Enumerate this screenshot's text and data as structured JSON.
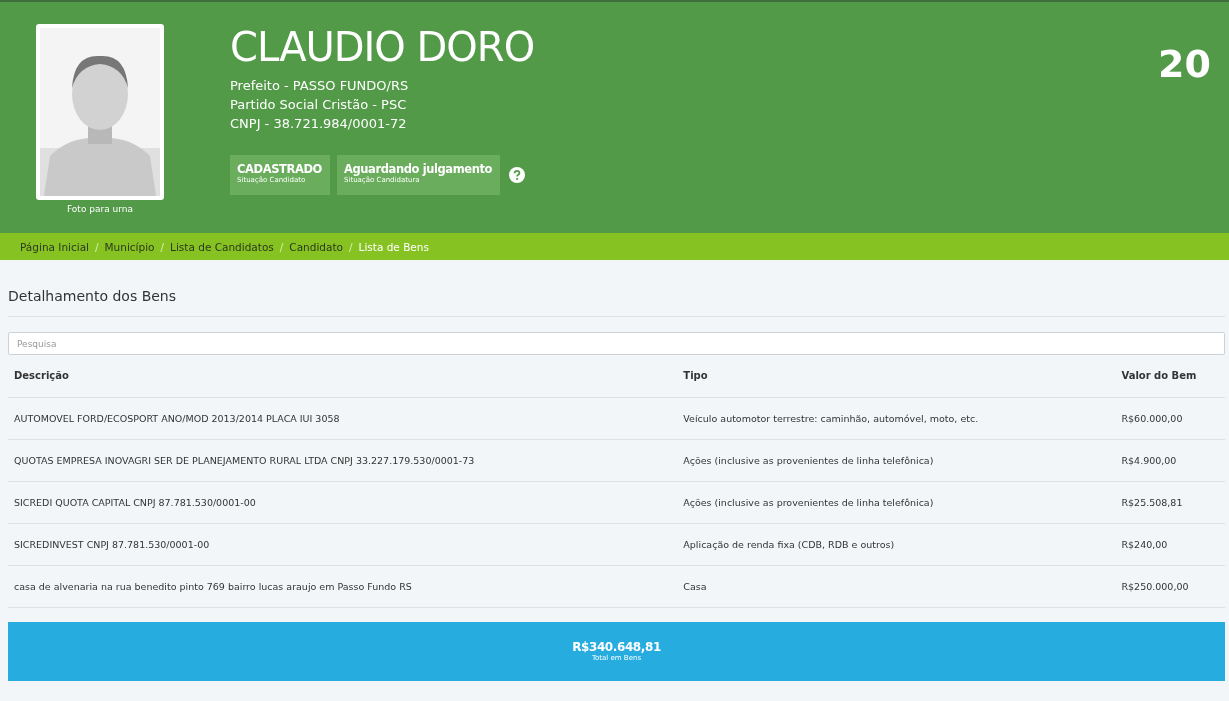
{
  "candidate": {
    "photo": {
      "kind": "picture",
      "caption": "Foto para urna"
    },
    "name": "CLAUDIO DORO",
    "number": "20",
    "details": [
      "Prefeito - PASSO FUNDO/RS",
      "Partido Social Cristão - PSC",
      "CNPJ - 38.721.984/0001-72"
    ],
    "badges": [
      {
        "value": "CADASTRADO",
        "label": "Situação Candidato"
      },
      {
        "value": "Aguardando julgamento",
        "label": "Situação Candidatura"
      }
    ]
  },
  "breadcrumb_separator": "/",
  "breadcrumb": [
    {
      "label": "Página Inicial",
      "current": false
    },
    {
      "label": "Município",
      "current": false
    },
    {
      "label": "Lista de Candidatos",
      "current": false
    },
    {
      "label": "Candidato",
      "current": false
    },
    {
      "label": "Lista de Bens",
      "current": true
    }
  ],
  "section_title": "Detalhamento dos Bens",
  "search": {
    "placeholder": "Pesquisa"
  },
  "table": {
    "columns": [
      "Descrição",
      "Tipo",
      "Valor do Bem"
    ],
    "rows": [
      [
        "AUTOMOVEL FORD/ECOSPORT ANO/MOD 2013/2014 PLACA IUI 3058",
        "Veículo automotor terrestre: caminhão, automóvel, moto, etc.",
        "R$60.000,00"
      ],
      [
        "QUOTAS EMPRESA INOVAGRI SER DE PLANEJAMENTO RURAL LTDA CNPJ 33.227.179.530/0001-73",
        "Ações (inclusive as provenientes de linha telefônica)",
        "R$4.900,00"
      ],
      [
        "SICREDI QUOTA CAPITAL CNPJ 87.781.530/0001-00",
        "Ações (inclusive as provenientes de linha telefônica)",
        "R$25.508,81"
      ],
      [
        "SICREDINVEST CNPJ 87.781.530/0001-00",
        "Aplicação de renda fixa (CDB, RDB e outros)",
        "R$240,00"
      ],
      [
        "casa de alvenaria na rua benedito pinto 769 bairro lucas araujo em Passo Fundo RS",
        "Casa",
        "R$250.000,00"
      ]
    ]
  },
  "total": {
    "value": "R$340.648,81",
    "label": "Total em Bens"
  }
}
